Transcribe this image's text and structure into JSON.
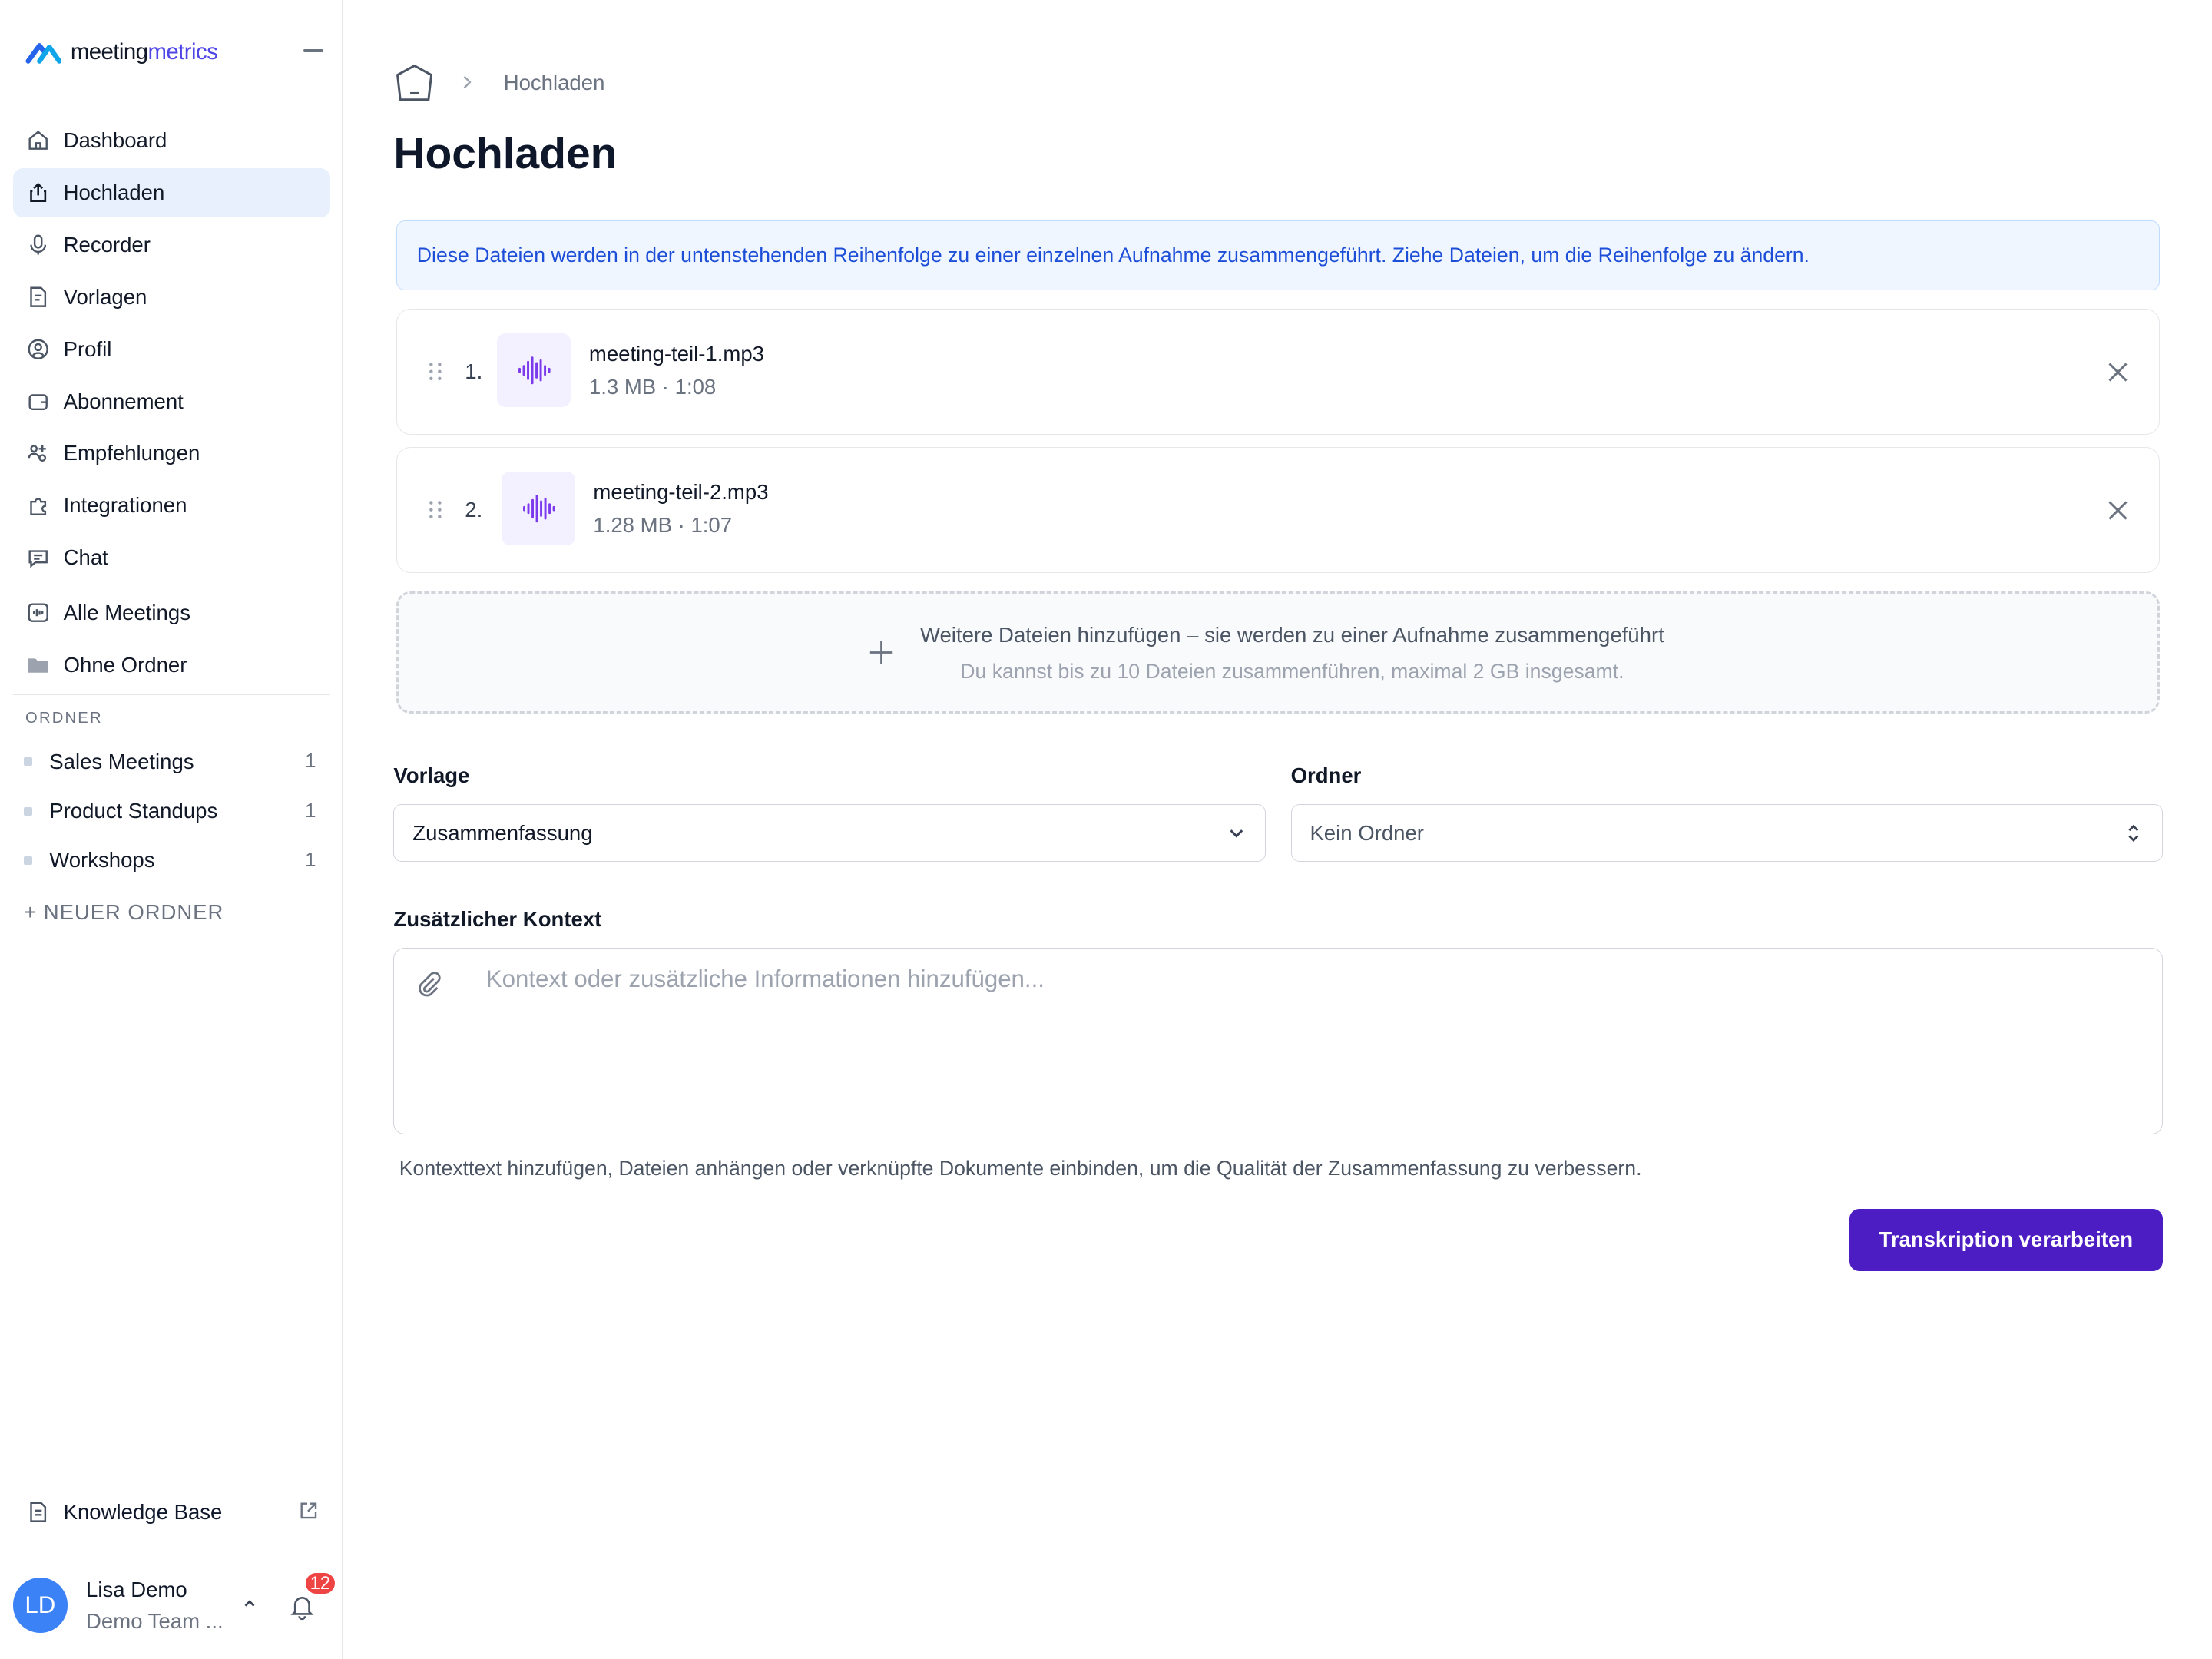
{
  "brand": {
    "name_part1": "meeting",
    "name_part2": "metrics"
  },
  "sidebar": {
    "items": [
      {
        "label": "Dashboard",
        "icon": "home-icon"
      },
      {
        "label": "Hochladen",
        "icon": "upload-icon",
        "active": true
      },
      {
        "label": "Recorder",
        "icon": "microphone-icon"
      },
      {
        "label": "Vorlagen",
        "icon": "template-icon"
      },
      {
        "label": "Profil",
        "icon": "profile-icon"
      },
      {
        "label": "Abonnement",
        "icon": "wallet-icon"
      },
      {
        "label": "Empfehlungen",
        "icon": "referral-icon"
      },
      {
        "label": "Integrationen",
        "icon": "puzzle-icon"
      },
      {
        "label": "Chat",
        "icon": "chat-icon"
      },
      {
        "label": "Alle Meetings",
        "icon": "audio-file-icon"
      },
      {
        "label": "Ohne Ordner",
        "icon": "folder-icon"
      }
    ],
    "folders_heading": "ORDNER",
    "folders": [
      {
        "name": "Sales Meetings",
        "count": "1"
      },
      {
        "name": "Product Standups",
        "count": "1"
      },
      {
        "name": "Workshops",
        "count": "1"
      }
    ],
    "new_folder": "+ NEUER ORDNER",
    "knowledge_base": "Knowledge Base",
    "user": {
      "initials": "LD",
      "name": "Lisa Demo",
      "team": "Demo Team ...",
      "notifications": "12"
    }
  },
  "main": {
    "breadcrumb": "Hochladen",
    "title": "Hochladen",
    "info": "Diese Dateien werden in der untenstehenden Reihenfolge zu einer einzelnen Aufnahme zusammengeführt. Ziehe Dateien, um die Reihenfolge zu ändern.",
    "files": [
      {
        "index": "1.",
        "name": "meeting-teil-1.mp3",
        "meta": "1.3 MB · 1:08"
      },
      {
        "index": "2.",
        "name": "meeting-teil-2.mp3",
        "meta": "1.28 MB · 1:07"
      }
    ],
    "dropzone": {
      "title": "Weitere Dateien hinzufügen – sie werden zu einer Aufnahme zusammengeführt",
      "subtitle": "Du kannst bis zu 10 Dateien zusammenführen, maximal 2 GB insgesamt."
    },
    "template_label": "Vorlage",
    "template_value": "Zusammenfassung",
    "folder_label": "Ordner",
    "folder_value": "Kein Ordner",
    "context_label": "Zusätzlicher Kontext",
    "context_placeholder": "Kontext oder zusätzliche Informationen hinzufügen...",
    "context_hint": "Kontexttext hinzufügen, Dateien anhängen oder verknüpfte Dokumente einbinden, um die Qualität der Zusammenfassung zu verbessern.",
    "submit": "Transkription verarbeiten"
  },
  "colors": {
    "accent": "#4c1dc2",
    "active_bg": "#e8f0fe",
    "info_text": "#1d4ed8",
    "badge": "#ef4444",
    "avatar": "#3b82f6"
  }
}
